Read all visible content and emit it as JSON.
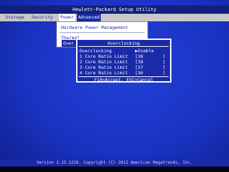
{
  "window": {
    "title": "Hewlett-Packard Setup Utility"
  },
  "menu": {
    "items": [
      "Storage",
      "Security",
      "Power",
      "Advanced"
    ],
    "active": "Power"
  },
  "power_menu": {
    "items": [
      "Hardware Power Management",
      "Thermal",
      "Overclocking"
    ]
  },
  "dialog": {
    "title": "Overclocking",
    "rows": [
      {
        "label": "Overclocking",
        "value": "▶Enable",
        "close": ""
      },
      {
        "label": "1 Core Ratio Limit",
        "value": "[38",
        "close": "]"
      },
      {
        "label": "2 Core Ratio Limit",
        "value": "[38",
        "close": "]"
      },
      {
        "label": "3 Core Ratio Limit",
        "value": "[37",
        "close": "]"
      },
      {
        "label": "4 Core Ratio Limit",
        "value": "[36",
        "close": "]"
      }
    ],
    "footer": "F10=Accept, ESC=Cancel"
  },
  "status_bar": {
    "text": "Version 2.15.1226. Copyright (C) 2012 American Megatrends, Inc."
  }
}
